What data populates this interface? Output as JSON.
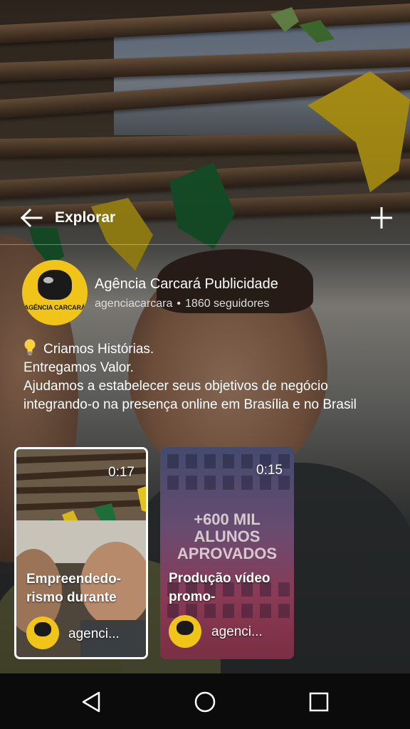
{
  "header": {
    "title": "Explorar",
    "back_icon": "arrow-left-icon",
    "add_icon": "plus-icon"
  },
  "profile": {
    "display_name": "Agência Carcará Publicidade",
    "username": "agenciacarcara",
    "separator": "•",
    "followers": "1860 seguidores",
    "avatar_text": "AGÊNCIA CARCARÁ"
  },
  "bio": {
    "icon": "light-bulb-icon",
    "line1": "Criamos Histórias.",
    "line2": "Entregamos Valor.",
    "line3": "Ajudamos a estabelecer seus objetivos de negócio integrando-o na presença online em Brasília e no Brasil"
  },
  "cards": [
    {
      "duration": "0:17",
      "title": "Empreendedo-rismo durante",
      "user": "agenci..."
    },
    {
      "duration": "0:15",
      "overlay_text": "+600 MIL ALUNOS APROVADOS",
      "title": "Produção vídeo promo-",
      "user": "agenci..."
    }
  ],
  "navbar": {
    "back_icon": "triangle-back-icon",
    "home_icon": "circle-home-icon",
    "recents_icon": "square-recents-icon"
  },
  "colors": {
    "brand_yellow": "#f0c419",
    "navbar": "#0b0b0b",
    "selected_border": "#ffffff"
  }
}
